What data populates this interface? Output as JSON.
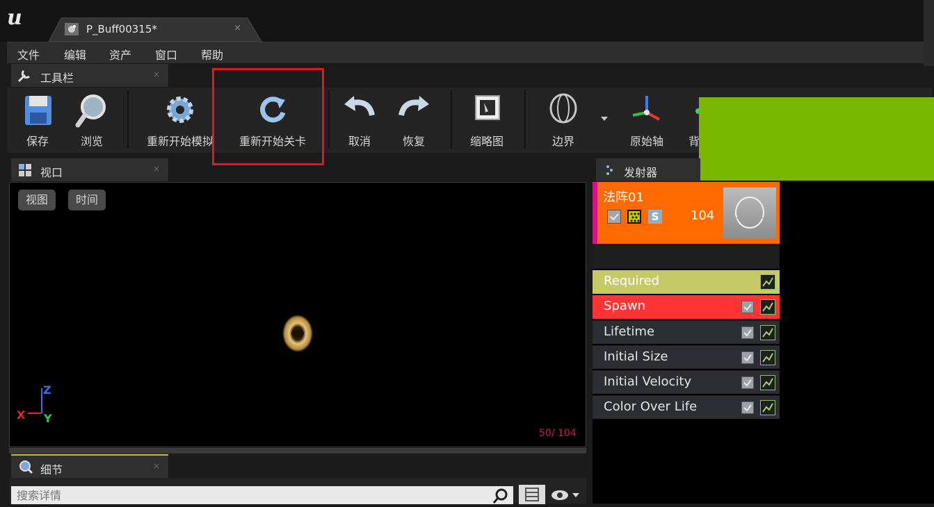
{
  "window": {
    "logo_text": "u",
    "tab_title": "P_Buff00315*",
    "tab_close": "×"
  },
  "menu": [
    "文件",
    "编辑",
    "资产",
    "窗口",
    "帮助"
  ],
  "toolbar_panel": {
    "tab_label": "工具栏",
    "close": "×",
    "buttons": [
      "保存",
      "浏览",
      "重新开始模拟",
      "重新开始关卡",
      "取消",
      "恢复",
      "缩略图",
      "边界",
      "原始轴",
      "背景"
    ]
  },
  "viewport_panel": {
    "tab_label": "视口",
    "close": "×",
    "view_button": "视图",
    "time_button": "时间",
    "particle_counter": "50/ 104",
    "axes": {
      "z": "Z",
      "x": "X",
      "y": "Y"
    }
  },
  "details_panel": {
    "tab_label": "细节",
    "close": "×",
    "search_placeholder": "搜索详情"
  },
  "emitters_panel": {
    "tab_label": "发射器",
    "emitter": {
      "name": "法阵01",
      "particle_count": "104",
      "solo_label": "S"
    },
    "modules": [
      {
        "label": "Required",
        "color": "#c6c968",
        "has_checkbox": false
      },
      {
        "label": "Spawn",
        "color": "#ff3535",
        "has_checkbox": true
      },
      {
        "label": "Lifetime",
        "color": "#2d2e33",
        "has_checkbox": true
      },
      {
        "label": "Initial Size",
        "color": "#2d2e33",
        "has_checkbox": true
      },
      {
        "label": "Initial Velocity",
        "color": "#2d2e33",
        "has_checkbox": true
      },
      {
        "label": "Color Over Life",
        "color": "#2d2e33",
        "has_checkbox": true
      }
    ]
  },
  "colors": {
    "emitter_card": "#ff6a00",
    "highlight_box": "#e8141d",
    "overlay_block": "#7ab800",
    "counter": "#c61a5c"
  }
}
